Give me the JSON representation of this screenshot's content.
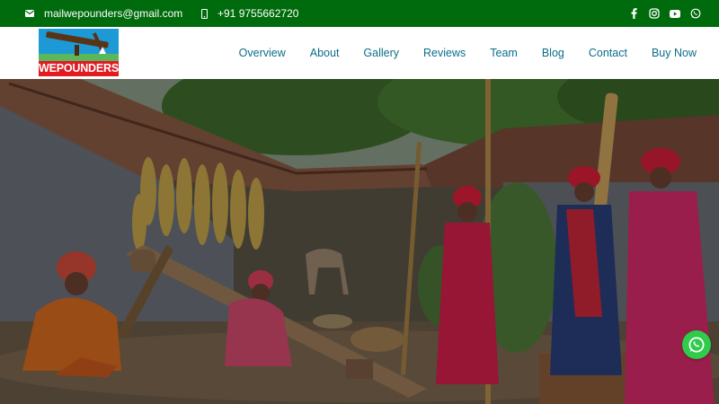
{
  "topbar": {
    "email": "mailwepounders@gmail.com",
    "phone": "+91 9755662720",
    "social": [
      "facebook-icon",
      "instagram-icon",
      "youtube-icon",
      "whatsapp-icon"
    ],
    "background": "#006b0c"
  },
  "logo": {
    "text": "WEPOUNDERS",
    "colors": {
      "sky": "#1d9ad6",
      "band": "#e01b22"
    }
  },
  "nav": {
    "items": [
      "Overview",
      "About",
      "Gallery",
      "Reviews",
      "Team",
      "Blog",
      "Contact",
      "Buy Now"
    ],
    "color": "#0b6d8a"
  },
  "floating": {
    "icon": "whatsapp-icon",
    "color": "#2ecc4a"
  }
}
